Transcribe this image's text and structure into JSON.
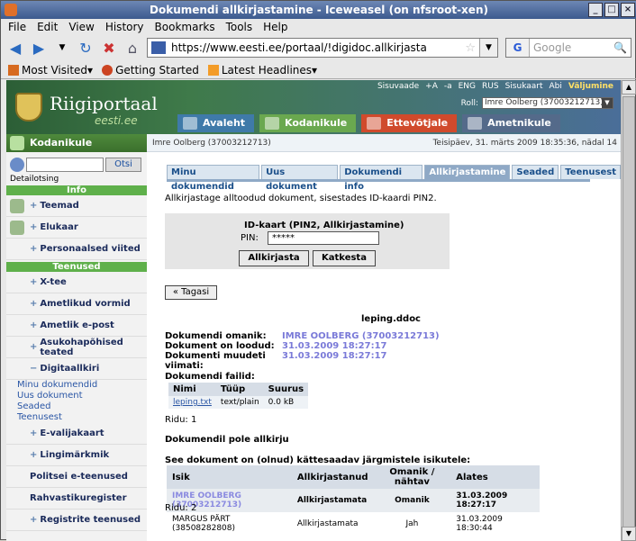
{
  "window": {
    "title": "Dokumendi allkirjastamine - Iceweasel (on nfsroot-xen)"
  },
  "menu": [
    "File",
    "Edit",
    "View",
    "History",
    "Bookmarks",
    "Tools",
    "Help"
  ],
  "nav": {
    "url": "https://www.eesti.ee/portaal/!digidoc.allkirjasta",
    "search_placeholder": "Google"
  },
  "bookmarks": [
    "Most Visited",
    "Getting Started",
    "Latest Headlines"
  ],
  "banner": {
    "logo": "Riigiportaal",
    "logo_sub": "eesti.ee",
    "toplinks": [
      "Sisuvaade",
      "+A",
      "-a",
      "ENG",
      "RUS",
      "Sisukaart",
      "Abi",
      "Väljumine"
    ],
    "role_label": "Roll:",
    "role_value": "Imre Oolberg (37003212713)",
    "tabs": [
      "Avaleht",
      "Kodanikule",
      "Ettevõtjale",
      "Ametnikule"
    ]
  },
  "sidebar": {
    "header": "Kodanikule",
    "search_button": "Otsi",
    "detail_link": "Detailotsing",
    "sect_info": "Info",
    "info_items": [
      "Teemad",
      "Elukaar",
      "Personaalsed viited"
    ],
    "sect_services": "Teenused",
    "service_items": [
      "X-tee",
      "Ametlikud vormid",
      "Ametlik e-post",
      "Asukohapõhised teated",
      "Digitaallkiri"
    ],
    "digi_sub": [
      "Minu dokumendid",
      "Uus dokument",
      "Seaded",
      "Teenusest"
    ],
    "more_items": [
      "E-valijakaart",
      "Lingimärkmik"
    ],
    "plain_items": [
      "Politsei e-teenused",
      "Rahvastikuregister"
    ],
    "last_item": "Registrite teenused"
  },
  "content": {
    "user": "Imre Oolberg (37003212713)",
    "date": "Teisipäev, 31. märts 2009 18:35:36, nädal 14",
    "subtabs": [
      "Minu dokumendid",
      "Uus dokument",
      "Dokumendi info",
      "Allkirjastamine",
      "Seaded",
      "Teenusest"
    ],
    "intro": "Allkirjastage alltoodud dokument, sisestades ID-kaardi PIN2.",
    "pin_title": "ID-kaart (PIN2, Allkirjastamine)",
    "pin_label": "PIN:",
    "pin_value": "*****",
    "btn_sign": "Allkirjasta",
    "btn_cancel": "Katkesta",
    "btn_back": "« Tagasi",
    "doc_name": "leping.ddoc",
    "meta": [
      {
        "k": "Dokumendi omanik:",
        "v": "IMRE OOLBERG (37003212713)"
      },
      {
        "k": "Dokument on loodud:",
        "v": "31.03.2009 18:27:17"
      },
      {
        "k": "Dokumenti muudeti viimati:",
        "v": "31.03.2009 18:27:17"
      }
    ],
    "files_title": "Dokumendi failid:",
    "files_head": [
      "Nimi",
      "Tüüp",
      "Suurus"
    ],
    "files_row": [
      "leping.txt",
      "text/plain",
      "0.0 kB"
    ],
    "ridu1": "Ridu: 1",
    "no_signature": "Dokumendil pole allkirju",
    "available": "See dokument on (olnud) kättesaadav järgmistele isikutele:",
    "people_head": [
      "Isik",
      "Allkirjastanud",
      "Omanik / nähtav",
      "Alates"
    ],
    "people_rows": [
      [
        "IMRE OOLBERG (37003212713)",
        "Allkirjastamata",
        "Omanik",
        "31.03.2009 18:27:17"
      ],
      [
        "MARGUS PÄRT (38508282808)",
        "Allkirjastamata",
        "Jah",
        "31.03.2009 18:30:44"
      ]
    ],
    "ridu2": "Ridu: 2"
  }
}
